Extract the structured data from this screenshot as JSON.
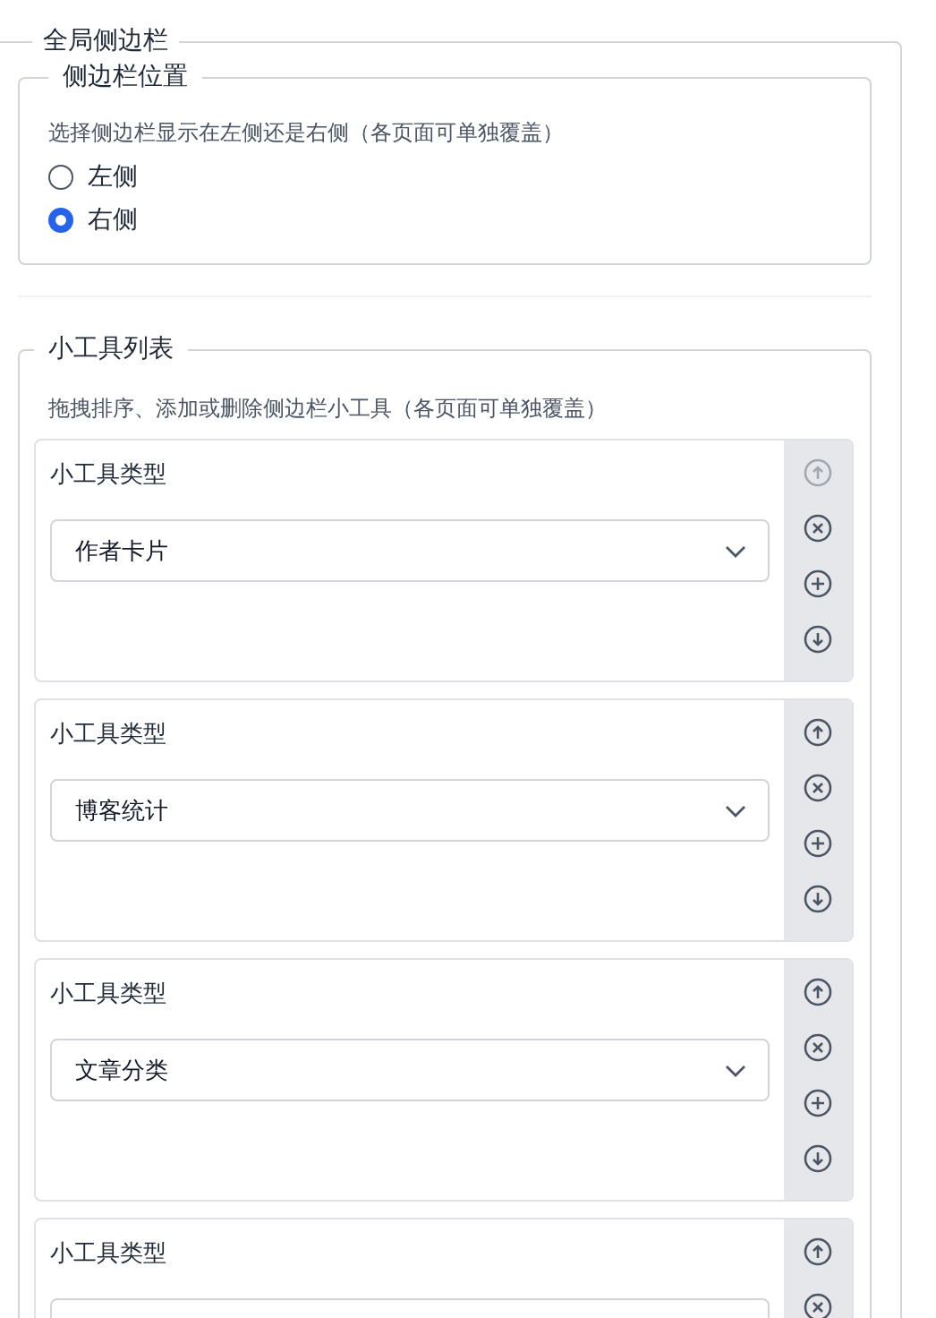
{
  "section": {
    "title": "全局侧边栏"
  },
  "position": {
    "title": "侧边栏位置",
    "description": "选择侧边栏显示在左侧还是右侧（各页面可单独覆盖）",
    "options": [
      {
        "label": "左侧",
        "selected": false
      },
      {
        "label": "右侧",
        "selected": true
      }
    ]
  },
  "widgets": {
    "title": "小工具列表",
    "description": "拖拽排序、添加或删除侧边栏小工具（各页面可单独覆盖）",
    "items": [
      {
        "kind": "full",
        "label": "小工具类型",
        "value": "作者卡片",
        "move_up_disabled": true
      },
      {
        "kind": "full",
        "label": "小工具类型",
        "value": "博客统计",
        "move_up_disabled": false
      },
      {
        "kind": "full",
        "label": "小工具类型",
        "value": "文章分类",
        "move_up_disabled": false
      },
      {
        "kind": "partial",
        "label": "小工具类型",
        "move_up_disabled": false
      }
    ]
  }
}
